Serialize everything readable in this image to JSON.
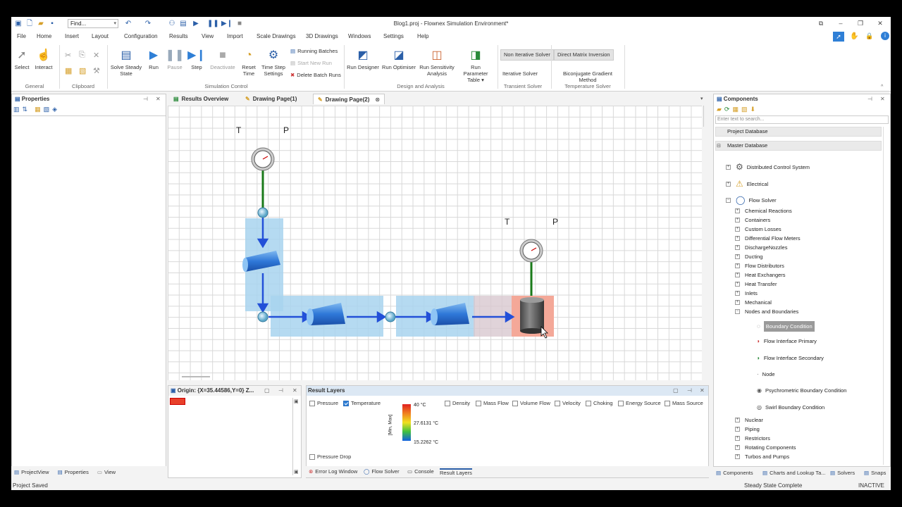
{
  "window": {
    "title": "Blog1.proj - Flownex Simulation Environment*"
  },
  "quick_access": {
    "find_placeholder": "Find..."
  },
  "menu": [
    "File",
    "Home",
    "Insert",
    "Layout",
    "Configuration",
    "Results",
    "View",
    "Import",
    "Scale Drawings",
    "3D Drawings",
    "Windows",
    "Settings",
    "Help"
  ],
  "ribbon": {
    "select": "Select",
    "interact": "Interact",
    "group_general": "General",
    "group_clipboard": "Clipboard",
    "solve": "Solve Steady State",
    "run": "Run",
    "pause": "Pause",
    "step": "Step",
    "deactivate": "Deactivate",
    "reset": "Reset Time",
    "timestep": "Time Step Settings",
    "running_batches": "Running Batches",
    "start_new_run": "Start New Run",
    "delete_batch_runs": "Delete Batch Runs",
    "group_sim": "Simulation Control",
    "run_designer": "Run Designer",
    "run_optimiser": "Run Optimiser",
    "run_sensitivity": "Run Sensitivity Analysis",
    "run_param": "Run Parameter Table",
    "group_design": "Design and Analysis",
    "non_iter": "Non Iterative Solver",
    "iter": "Iterative Solver",
    "group_transient": "Transient Solver",
    "direct_matrix": "Direct Matrix Inversion",
    "biconj": "Biconjugate Gradient Method",
    "group_temp": "Temperature Solver"
  },
  "properties": {
    "title": "Properties"
  },
  "doc_tabs": [
    "Results Overview",
    "Drawing Page(1)",
    "Drawing Page(2)"
  ],
  "canvas": {
    "t_label": "T",
    "p_label": "P"
  },
  "origin_panel": {
    "title": "Origin: {X=35.44586,Y=0} Z..."
  },
  "result_layers": {
    "title": "Result Layers",
    "checks": [
      {
        "label": "Pressure",
        "on": false
      },
      {
        "label": "Temperature",
        "on": true
      },
      {
        "label": "Density",
        "on": false
      },
      {
        "label": "Mass Flow",
        "on": false
      },
      {
        "label": "Volume Flow",
        "on": false
      },
      {
        "label": "Velocity",
        "on": false
      },
      {
        "label": "Choking",
        "on": false
      },
      {
        "label": "Energy Source",
        "on": false
      },
      {
        "label": "Mass Source",
        "on": false
      }
    ],
    "pressure_drop": "Pressure Drop",
    "scale_max": "40 °C",
    "scale_mid": "27.6131 °C",
    "scale_min": "15.2262 °C",
    "scale_label": "[Min, Max]"
  },
  "bottom_tabs": {
    "error_log": "Error Log Window",
    "flow_solver": "Flow Solver",
    "console": "Console",
    "result_layers": "Result Layers"
  },
  "left_bottom_tabs": [
    "ProjectView",
    "Properties",
    "View"
  ],
  "components": {
    "title": "Components",
    "search_placeholder": "Enter text to search...",
    "project_db": "Project Database",
    "master_db": "Master Database",
    "top": [
      "Distributed Control System",
      "Electrical",
      "Flow Solver"
    ],
    "flow_children": [
      "Chemical Reactions",
      "Containers",
      "Custom Losses",
      "Differential Flow Meters",
      "DischargeNozzles",
      "Ducting",
      "Flow Distributors",
      "Heat Exchangers",
      "Heat Transfer",
      "Inlets",
      "Mechanical",
      "Nodes and Boundaries"
    ],
    "nodes_children": [
      "Boundary Condition",
      "Flow Interface Primary",
      "Flow Interface Secondary",
      "Node",
      "Psychrometric Boundary Condition",
      "Swirl Boundary Condition"
    ],
    "after": [
      "Nuclear",
      "Piping",
      "Restrictors",
      "Rotating Components",
      "Turbos and Pumps"
    ],
    "bottom_tabs": [
      "Components",
      "Charts and Lookup Ta...",
      "Solvers",
      "Snaps"
    ]
  },
  "status": {
    "left": "Project Saved",
    "mid": "Steady State Complete",
    "right": "INACTIVE"
  },
  "colors": {
    "accent": "#2b5fa8",
    "selection": "#a8d4ee",
    "pipe": "#2350d8"
  }
}
